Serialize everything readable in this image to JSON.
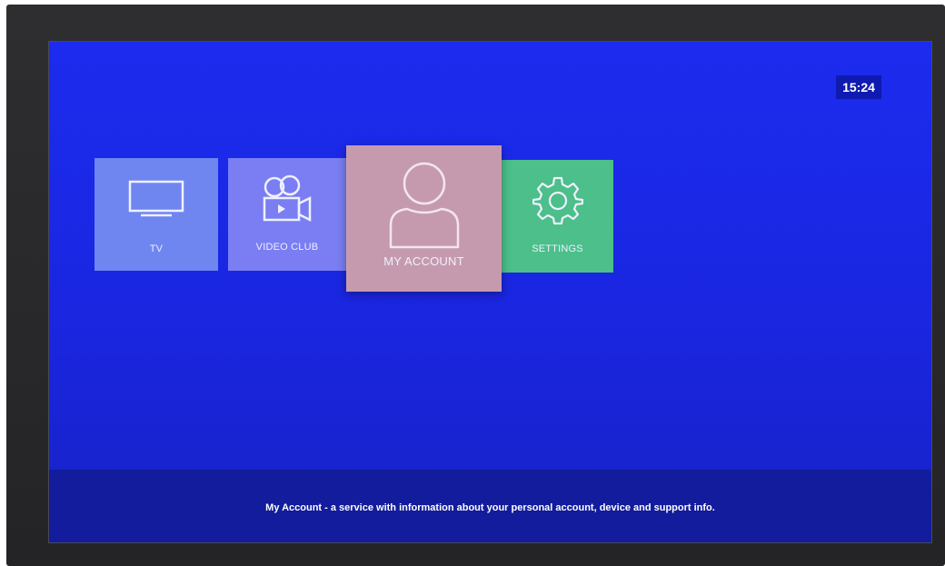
{
  "clock": {
    "time": "15:24"
  },
  "menu": {
    "items": [
      {
        "label": "TV",
        "icon": "tv-icon",
        "color": "#6f86f0",
        "selected": false
      },
      {
        "label": "VIDEO CLUB",
        "icon": "video-camera-icon",
        "color": "#7a7ef2",
        "selected": false
      },
      {
        "label": "MY ACCOUNT",
        "icon": "user-icon",
        "color": "#c69aae",
        "selected": true
      },
      {
        "label": "SETTINGS",
        "icon": "gear-icon",
        "color": "#4cbf8a",
        "selected": false
      }
    ]
  },
  "info": {
    "description": "My Account - a service with information about your personal account, device and support info."
  }
}
